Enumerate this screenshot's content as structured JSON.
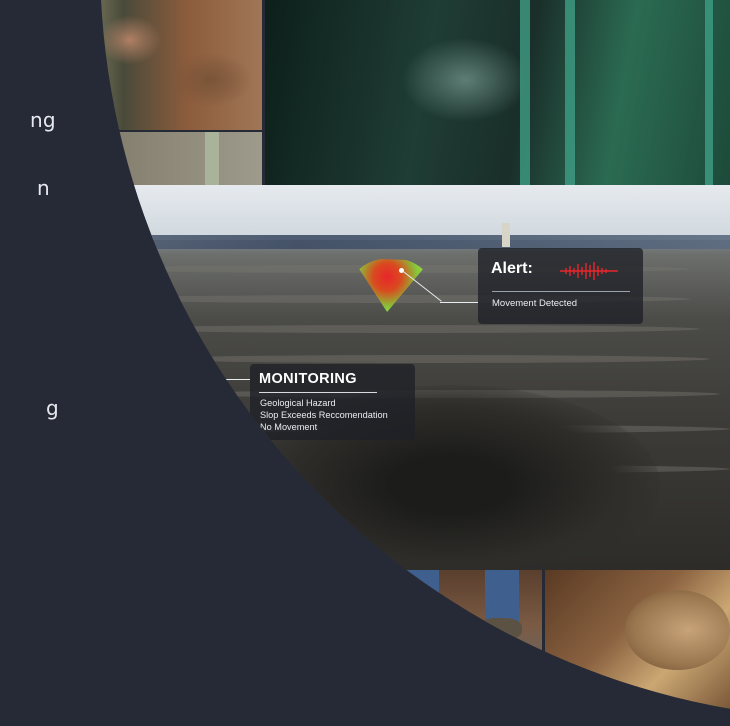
{
  "sidebar": {
    "items": [
      {
        "label": "ng"
      },
      {
        "label": "n"
      },
      {
        "label": "g"
      }
    ]
  },
  "alert_card": {
    "title": "Alert:",
    "subtitle": "Movement Detected",
    "wave_color": "#e8262b"
  },
  "monitoring_card": {
    "title": "MONITORING",
    "lines": [
      "Geological Hazard",
      "Slop Exceeds Reccomendation",
      "No Movement"
    ]
  },
  "colors": {
    "background": "#262a36",
    "heat_red": "#e8262b",
    "heat_green": "#84c93a"
  }
}
